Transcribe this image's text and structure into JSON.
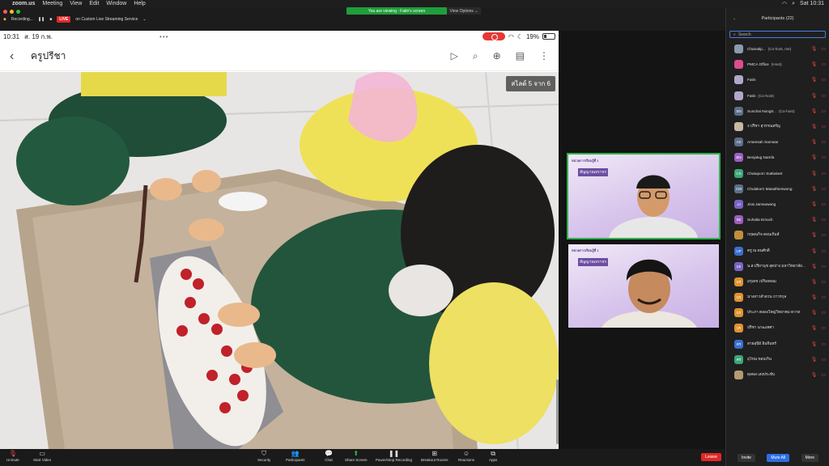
{
  "menubar": {
    "app": "zoom.us",
    "items": [
      "Meeting",
      "View",
      "Edit",
      "Window",
      "Help"
    ],
    "time": "Sat 10:31"
  },
  "status": {
    "recording": "Recording...",
    "live_badge": "LIVE",
    "live_service": "on Custom Live Streaming Service",
    "viewing": "You are viewing : Fatin's screen",
    "view_options": "View Options"
  },
  "share": {
    "ios_time": "10:31",
    "ios_date": "ส. 19 ก.พ.",
    "battery": "19%",
    "title": "ครูปรีชา",
    "slide_badge": "สไลด์ 5 จาก 6"
  },
  "gallery": {
    "slide_title": "หน่วยการเรียนรู้ที่ 1",
    "slide_sub": "สัญญาณจราจร"
  },
  "panel": {
    "title": "Participants (22)",
    "view": "View",
    "search_placeholder": "Search",
    "invite": "Invite",
    "mute_all": "Mute All",
    "more": "More"
  },
  "participants": [
    {
      "initials": "",
      "name": "Chanatip...",
      "role": "(Co-host, me)",
      "color": "#8a9bb0"
    },
    {
      "initials": "",
      "name": "PMCA Office",
      "role": "(Host)",
      "color": "#d94f8c"
    },
    {
      "initials": "",
      "name": "Fatin",
      "role": "",
      "color": "#b1a7c9"
    },
    {
      "initials": "",
      "name": "Fatin",
      "role": "(Co-host)",
      "color": "#b1a7c9"
    },
    {
      "initials": "SN",
      "name": "Sunchai Nongtr...",
      "role": "(Co-host)",
      "color": "#5b6f8a"
    },
    {
      "initials": "",
      "name": "3 ปรีชา สุวรรณสรัญ",
      "role": "",
      "color": "#c7b9a2"
    },
    {
      "initials": "AS",
      "name": "Arseesah Samsae",
      "role": "",
      "color": "#5b6f8a"
    },
    {
      "initials": "BN",
      "name": "Benjalug Namfa",
      "role": "",
      "color": "#9b5fc0"
    },
    {
      "initials": "CS",
      "name": "Chatuporn Suttiwiset",
      "role": "",
      "color": "#3aa77a"
    },
    {
      "initials": "CM",
      "name": "Chulakorn Masathienwong",
      "role": "",
      "color": "#5b6f8a"
    },
    {
      "initials": "JJ",
      "name": "Jirat Jamsawang",
      "role": "",
      "color": "#7a63c4"
    },
    {
      "initials": "SE",
      "name": "Suhaila Emoch",
      "role": "",
      "color": "#9b5fc0"
    },
    {
      "initials": "",
      "name": "กฤษณกิจ ดอนเกิมส์",
      "role": "",
      "color": "#c28e3d"
    },
    {
      "initials": "UP",
      "name": "ครู ณ ดนศักดิ์",
      "role": "",
      "color": "#3a6fcf"
    },
    {
      "initials": "มจ",
      "name": "น.ส.ปรียานุช สุดปาง มหาวิทยาลัย...",
      "role": "",
      "color": "#7a63c4"
    },
    {
      "initials": "มร",
      "name": "มรุเดช เปรีงลหอม",
      "role": "",
      "color": "#e0922e"
    },
    {
      "initials": "มร",
      "name": "นางสาวลำดวน ถาวรกุล",
      "role": "",
      "color": "#e0922e"
    },
    {
      "initials": "มร",
      "name": "ประภา ตลองใหญ่วิทยาคม ดวาด",
      "role": "",
      "color": "#e0922e"
    },
    {
      "initials": "ปร",
      "name": "ปรีชา นาฒเทศา",
      "role": "",
      "color": "#e0922e"
    },
    {
      "initials": "คร",
      "name": "สายสุนีย์ อินจีนทร์",
      "role": "",
      "color": "#3a6fcf"
    },
    {
      "initials": "คร",
      "name": "อุไรณ ขอบเกิน",
      "role": "",
      "color": "#3aa77a"
    },
    {
      "initials": "",
      "name": "ดุลพล เสงประทับ",
      "role": "",
      "color": "#b69b6f"
    }
  ],
  "toolbar": {
    "unmute": "Unmute",
    "start_video": "Start Video",
    "security": "Security",
    "participants": "Participants",
    "participants_count": "22",
    "chat": "Chat",
    "share_screen": "Share Screen",
    "pause_recording": "Pause/Stop Recording",
    "breakout": "Breakout Rooms",
    "reactions": "Reactions",
    "apps": "Apps",
    "leave": "Leave"
  },
  "colors": {
    "accent_green": "#2fb34c",
    "leave_red": "#e02828",
    "mute_red": "#e24b4b"
  }
}
